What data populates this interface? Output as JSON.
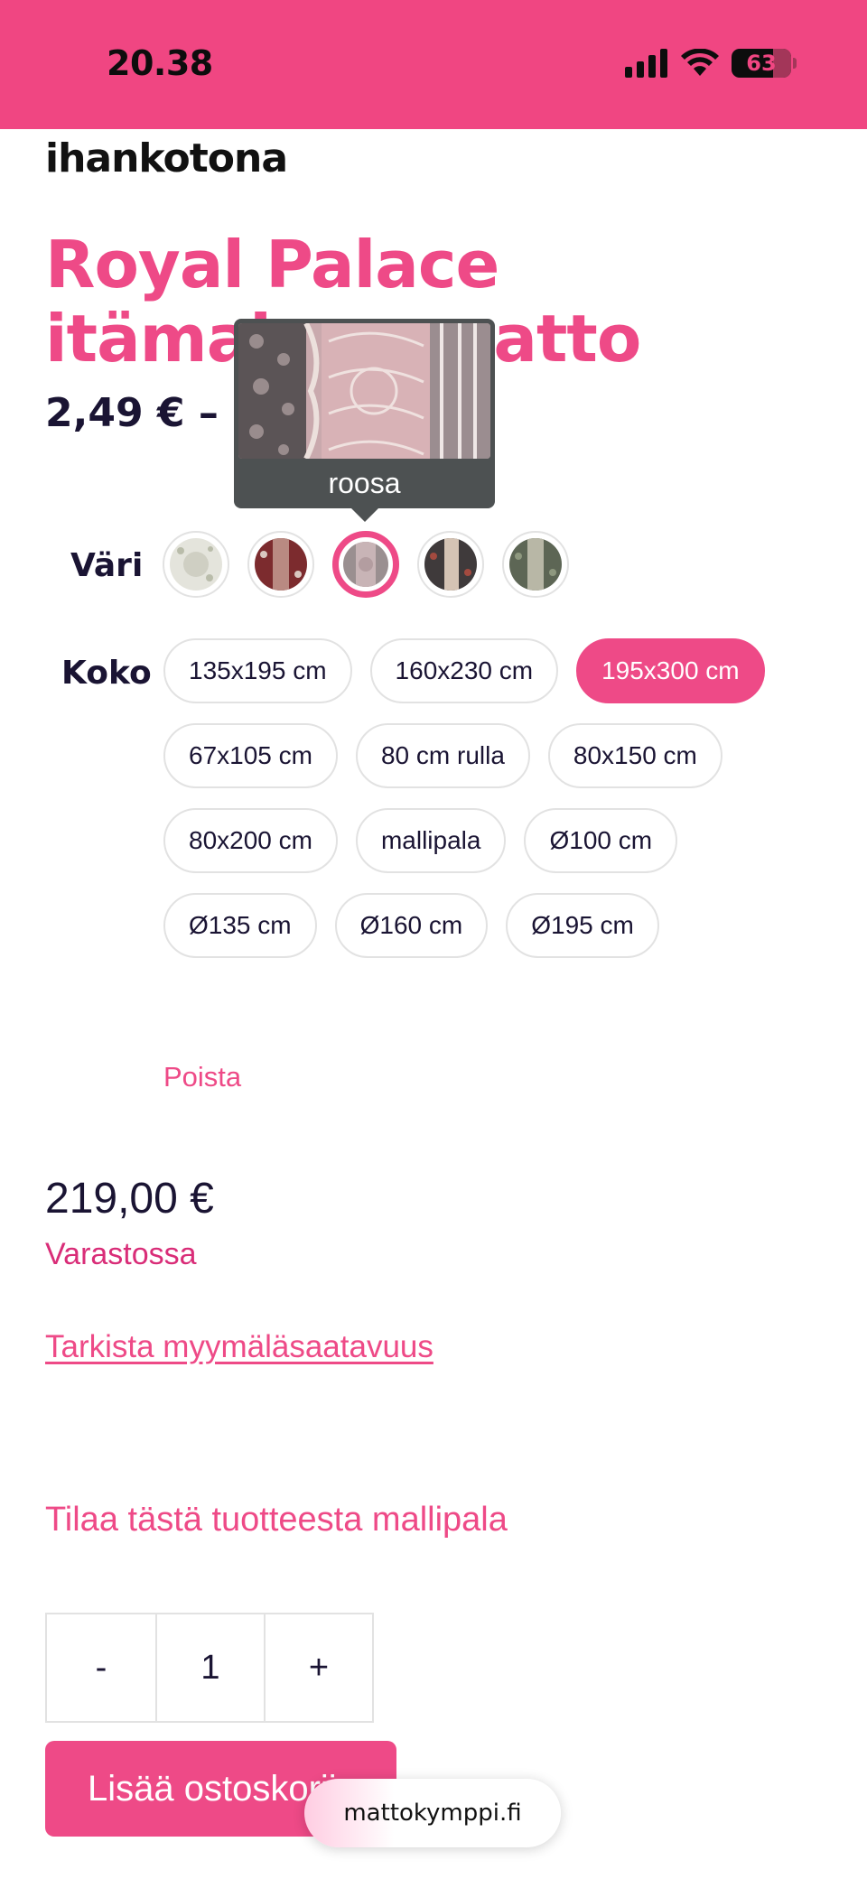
{
  "status_bar": {
    "time": "20.38",
    "battery": "63",
    "background": "#f04682"
  },
  "brand": {
    "logo": "ihankotona"
  },
  "product": {
    "title": "Royal Palace itämainen matto",
    "price_range": "2,49 € – 2",
    "accent_color": "#ee4a87"
  },
  "tooltip": {
    "label": "roosa"
  },
  "options": {
    "color_label": "Väri",
    "size_label": "Koko",
    "colors": [
      {
        "name": "light",
        "selected": false
      },
      {
        "name": "red",
        "selected": false
      },
      {
        "name": "roosa",
        "selected": true
      },
      {
        "name": "dark",
        "selected": false
      },
      {
        "name": "green",
        "selected": false
      }
    ],
    "sizes": [
      {
        "label": "135x195 cm",
        "selected": false
      },
      {
        "label": "160x230 cm",
        "selected": false
      },
      {
        "label": "195x300 cm",
        "selected": true
      },
      {
        "label": "67x105 cm",
        "selected": false
      },
      {
        "label": "80 cm rulla",
        "selected": false
      },
      {
        "label": "80x150 cm",
        "selected": false
      },
      {
        "label": "80x200 cm",
        "selected": false
      },
      {
        "label": "mallipala",
        "selected": false
      },
      {
        "label": "Ø100 cm",
        "selected": false
      },
      {
        "label": "Ø135 cm",
        "selected": false
      },
      {
        "label": "Ø160 cm",
        "selected": false
      },
      {
        "label": "Ø195 cm",
        "selected": false
      }
    ],
    "clear_label": "Poista"
  },
  "purchase": {
    "price": "219,00 €",
    "stock": "Varastossa",
    "availability_link": "Tarkista myymäläsaatavuus",
    "sample_link": "Tilaa tästä tuotteesta mallipala",
    "qty_minus": "-",
    "qty_value": "1",
    "qty_plus": "+",
    "add_to_cart": "Lisää ostoskoriin"
  },
  "browser": {
    "url": "mattokymppi.fi"
  }
}
